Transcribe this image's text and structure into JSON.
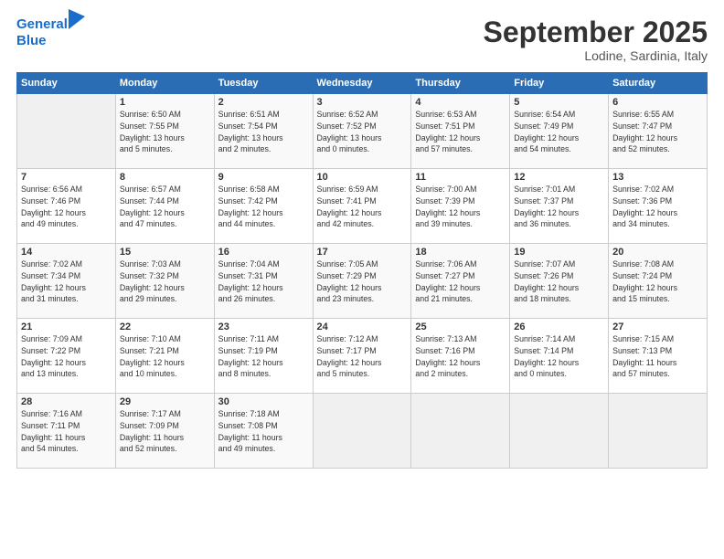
{
  "logo": {
    "line1": "General",
    "line2": "Blue"
  },
  "header": {
    "month": "September 2025",
    "location": "Lodine, Sardinia, Italy"
  },
  "weekdays": [
    "Sunday",
    "Monday",
    "Tuesday",
    "Wednesday",
    "Thursday",
    "Friday",
    "Saturday"
  ],
  "weeks": [
    [
      {
        "num": "",
        "info": ""
      },
      {
        "num": "1",
        "info": "Sunrise: 6:50 AM\nSunset: 7:55 PM\nDaylight: 13 hours\nand 5 minutes."
      },
      {
        "num": "2",
        "info": "Sunrise: 6:51 AM\nSunset: 7:54 PM\nDaylight: 13 hours\nand 2 minutes."
      },
      {
        "num": "3",
        "info": "Sunrise: 6:52 AM\nSunset: 7:52 PM\nDaylight: 13 hours\nand 0 minutes."
      },
      {
        "num": "4",
        "info": "Sunrise: 6:53 AM\nSunset: 7:51 PM\nDaylight: 12 hours\nand 57 minutes."
      },
      {
        "num": "5",
        "info": "Sunrise: 6:54 AM\nSunset: 7:49 PM\nDaylight: 12 hours\nand 54 minutes."
      },
      {
        "num": "6",
        "info": "Sunrise: 6:55 AM\nSunset: 7:47 PM\nDaylight: 12 hours\nand 52 minutes."
      }
    ],
    [
      {
        "num": "7",
        "info": "Sunrise: 6:56 AM\nSunset: 7:46 PM\nDaylight: 12 hours\nand 49 minutes."
      },
      {
        "num": "8",
        "info": "Sunrise: 6:57 AM\nSunset: 7:44 PM\nDaylight: 12 hours\nand 47 minutes."
      },
      {
        "num": "9",
        "info": "Sunrise: 6:58 AM\nSunset: 7:42 PM\nDaylight: 12 hours\nand 44 minutes."
      },
      {
        "num": "10",
        "info": "Sunrise: 6:59 AM\nSunset: 7:41 PM\nDaylight: 12 hours\nand 42 minutes."
      },
      {
        "num": "11",
        "info": "Sunrise: 7:00 AM\nSunset: 7:39 PM\nDaylight: 12 hours\nand 39 minutes."
      },
      {
        "num": "12",
        "info": "Sunrise: 7:01 AM\nSunset: 7:37 PM\nDaylight: 12 hours\nand 36 minutes."
      },
      {
        "num": "13",
        "info": "Sunrise: 7:02 AM\nSunset: 7:36 PM\nDaylight: 12 hours\nand 34 minutes."
      }
    ],
    [
      {
        "num": "14",
        "info": "Sunrise: 7:02 AM\nSunset: 7:34 PM\nDaylight: 12 hours\nand 31 minutes."
      },
      {
        "num": "15",
        "info": "Sunrise: 7:03 AM\nSunset: 7:32 PM\nDaylight: 12 hours\nand 29 minutes."
      },
      {
        "num": "16",
        "info": "Sunrise: 7:04 AM\nSunset: 7:31 PM\nDaylight: 12 hours\nand 26 minutes."
      },
      {
        "num": "17",
        "info": "Sunrise: 7:05 AM\nSunset: 7:29 PM\nDaylight: 12 hours\nand 23 minutes."
      },
      {
        "num": "18",
        "info": "Sunrise: 7:06 AM\nSunset: 7:27 PM\nDaylight: 12 hours\nand 21 minutes."
      },
      {
        "num": "19",
        "info": "Sunrise: 7:07 AM\nSunset: 7:26 PM\nDaylight: 12 hours\nand 18 minutes."
      },
      {
        "num": "20",
        "info": "Sunrise: 7:08 AM\nSunset: 7:24 PM\nDaylight: 12 hours\nand 15 minutes."
      }
    ],
    [
      {
        "num": "21",
        "info": "Sunrise: 7:09 AM\nSunset: 7:22 PM\nDaylight: 12 hours\nand 13 minutes."
      },
      {
        "num": "22",
        "info": "Sunrise: 7:10 AM\nSunset: 7:21 PM\nDaylight: 12 hours\nand 10 minutes."
      },
      {
        "num": "23",
        "info": "Sunrise: 7:11 AM\nSunset: 7:19 PM\nDaylight: 12 hours\nand 8 minutes."
      },
      {
        "num": "24",
        "info": "Sunrise: 7:12 AM\nSunset: 7:17 PM\nDaylight: 12 hours\nand 5 minutes."
      },
      {
        "num": "25",
        "info": "Sunrise: 7:13 AM\nSunset: 7:16 PM\nDaylight: 12 hours\nand 2 minutes."
      },
      {
        "num": "26",
        "info": "Sunrise: 7:14 AM\nSunset: 7:14 PM\nDaylight: 12 hours\nand 0 minutes."
      },
      {
        "num": "27",
        "info": "Sunrise: 7:15 AM\nSunset: 7:13 PM\nDaylight: 11 hours\nand 57 minutes."
      }
    ],
    [
      {
        "num": "28",
        "info": "Sunrise: 7:16 AM\nSunset: 7:11 PM\nDaylight: 11 hours\nand 54 minutes."
      },
      {
        "num": "29",
        "info": "Sunrise: 7:17 AM\nSunset: 7:09 PM\nDaylight: 11 hours\nand 52 minutes."
      },
      {
        "num": "30",
        "info": "Sunrise: 7:18 AM\nSunset: 7:08 PM\nDaylight: 11 hours\nand 49 minutes."
      },
      {
        "num": "",
        "info": ""
      },
      {
        "num": "",
        "info": ""
      },
      {
        "num": "",
        "info": ""
      },
      {
        "num": "",
        "info": ""
      }
    ]
  ]
}
